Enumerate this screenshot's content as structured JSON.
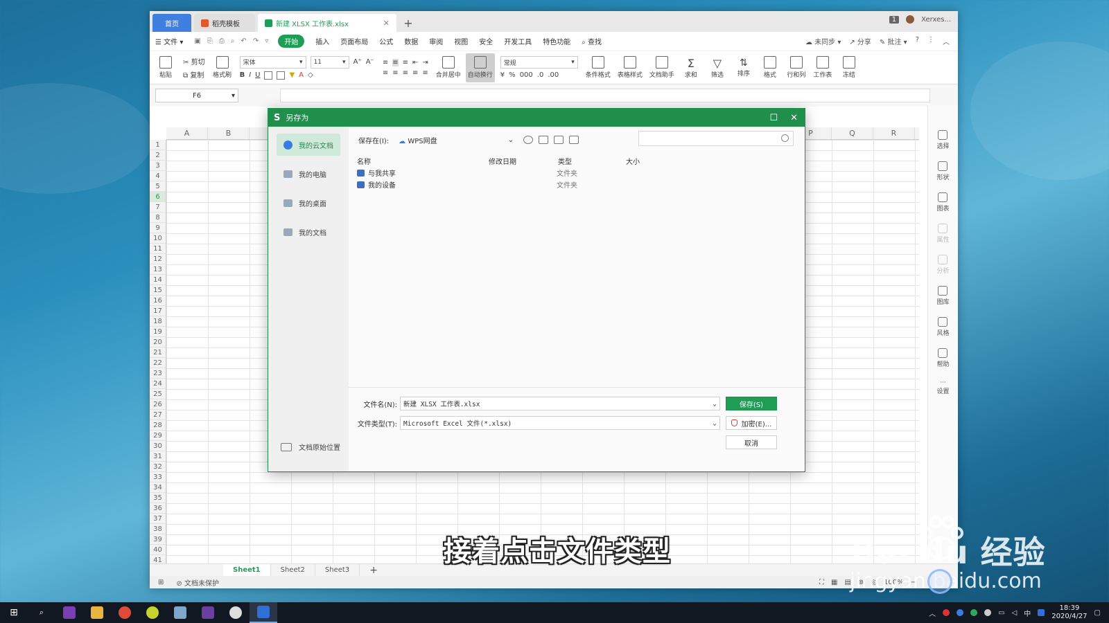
{
  "tabs": {
    "home": "首页",
    "templates": "稻壳模板",
    "file": "新建 XLSX 工作表.xlsx"
  },
  "titlebar_right": {
    "badge": "1",
    "user": "Xerxes..."
  },
  "menu": {
    "file": "文件",
    "items": [
      "开始",
      "插入",
      "页面布局",
      "公式",
      "数据",
      "审阅",
      "视图",
      "安全",
      "开发工具",
      "特色功能"
    ],
    "search": "查找",
    "sync": "未同步",
    "share": "分享",
    "comment": "批注"
  },
  "ribbon": {
    "paste": "粘贴",
    "cut": "剪切",
    "copy": "复制",
    "format_painter": "格式刷",
    "font": "宋体",
    "font_size": "11",
    "merge": "合并居中",
    "wrap": "自动换行",
    "number_format": "常规",
    "cond_format": "条件格式",
    "table_style": "表格样式",
    "doc_assist": "文档助手",
    "sum": "求和",
    "filter": "筛选",
    "sort": "排序",
    "format": "格式",
    "rowcol": "行和列",
    "sheet": "工作表",
    "freeze": "冻结"
  },
  "namebox": "F6",
  "columns": [
    "A",
    "B",
    "",
    "",
    "",
    "",
    "",
    "",
    "",
    "",
    "",
    "",
    "",
    "",
    "",
    "P",
    "Q",
    "R"
  ],
  "rows": [
    "1",
    "2",
    "3",
    "4",
    "5",
    "6",
    "7",
    "8",
    "9",
    "10",
    "11",
    "12",
    "13",
    "14",
    "15",
    "16",
    "17",
    "18",
    "19",
    "20",
    "21",
    "22",
    "23",
    "24",
    "25",
    "26",
    "27",
    "28",
    "29",
    "30",
    "31",
    "32",
    "33",
    "34",
    "35",
    "36",
    "37",
    "38",
    "39",
    "40",
    "41"
  ],
  "side_panel": [
    "选择",
    "形状",
    "图表",
    "属性",
    "分析",
    "图库",
    "风格",
    "帮助",
    "设置"
  ],
  "sheets": [
    "Sheet1",
    "Sheet2",
    "Sheet3"
  ],
  "status": {
    "protect": "文档未保护",
    "zoom": "100%"
  },
  "dialog": {
    "title": "另存为",
    "sidebar": [
      "我的云文档",
      "我的电脑",
      "我的桌面",
      "我的文档"
    ],
    "sidebar_bottom": "文档原始位置",
    "save_in_label": "保存在(I):",
    "save_in_value": "WPS网盘",
    "search_placeholder": "",
    "columns": {
      "name": "名称",
      "date": "修改日期",
      "type": "类型",
      "size": "大小"
    },
    "files": [
      {
        "name": "与我共享",
        "type": "文件夹"
      },
      {
        "name": "我的设备",
        "type": "文件夹"
      }
    ],
    "filename_label": "文件名(N):",
    "filename_value": "新建 XLSX 工作表.xlsx",
    "filetype_label": "文件类型(T):",
    "filetype_value": "Microsoft Excel 文件(*.xlsx)",
    "save_button": "保存(S)",
    "encrypt_button": "加密(E)...",
    "cancel_button": "取消"
  },
  "subtitle": "接着点击文件类型",
  "watermark": {
    "brand": "Bai du 经验",
    "url": "jingyan.baidu.com"
  },
  "taskbar": {
    "ime": "中",
    "time": "18:39",
    "date": "2020/4/27"
  },
  "colors": {
    "wps_green": "#1f9d55",
    "dialog_green": "#1f8f4b",
    "home_tab_blue": "#3f7fe0"
  }
}
